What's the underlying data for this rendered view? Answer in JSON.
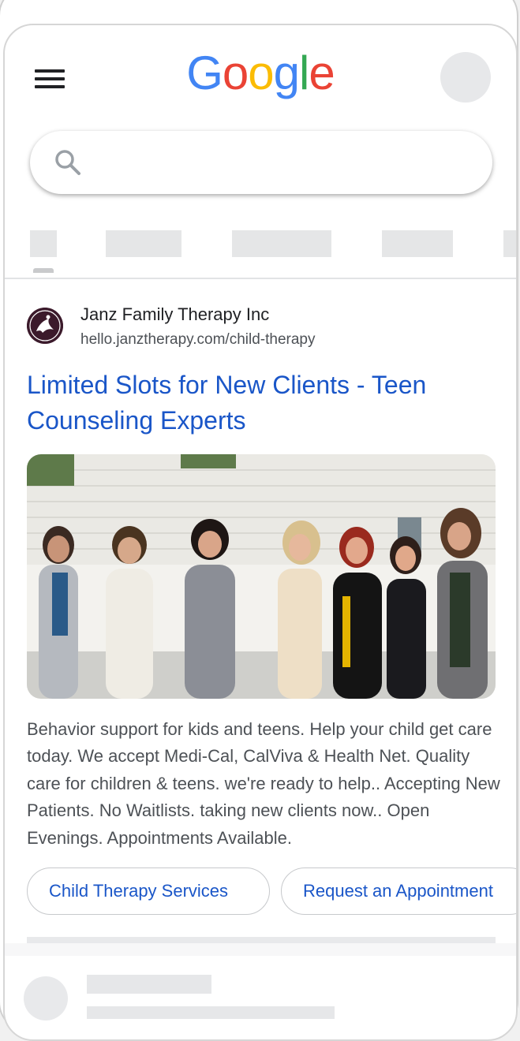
{
  "header": {
    "logo_letters": [
      {
        "char": "G",
        "color": "#4285F4"
      },
      {
        "char": "o",
        "color": "#EA4335"
      },
      {
        "char": "o",
        "color": "#FBBC05"
      },
      {
        "char": "g",
        "color": "#4285F4"
      },
      {
        "char": "l",
        "color": "#34A853"
      },
      {
        "char": "e",
        "color": "#EA4335"
      }
    ],
    "menu_icon": "hamburger-menu-icon",
    "account_icon": "avatar-placeholder"
  },
  "search": {
    "value": "",
    "icon": "search-icon"
  },
  "ad": {
    "advertiser": "Janz Family Therapy Inc",
    "url": "hello.janztherapy.com/child-therapy",
    "title": "Limited Slots for New Clients - Teen Counseling Experts",
    "description": "Behavior support for kids and teens. Help your child get care today. We accept Medi-Cal, CalViva & Health Net. Quality care for children & teens. we're ready to help.. Accepting New Patients. No Waitlists. taking new clients now.. Open Evenings. Appointments Available.",
    "sitelinks": [
      "Child Therapy Services",
      "Request an Appointment"
    ]
  },
  "colors": {
    "link_blue": "#1a56c8",
    "text_dark": "#202124",
    "text_gray": "#4d5156",
    "skeleton": "#e5e6e7"
  }
}
